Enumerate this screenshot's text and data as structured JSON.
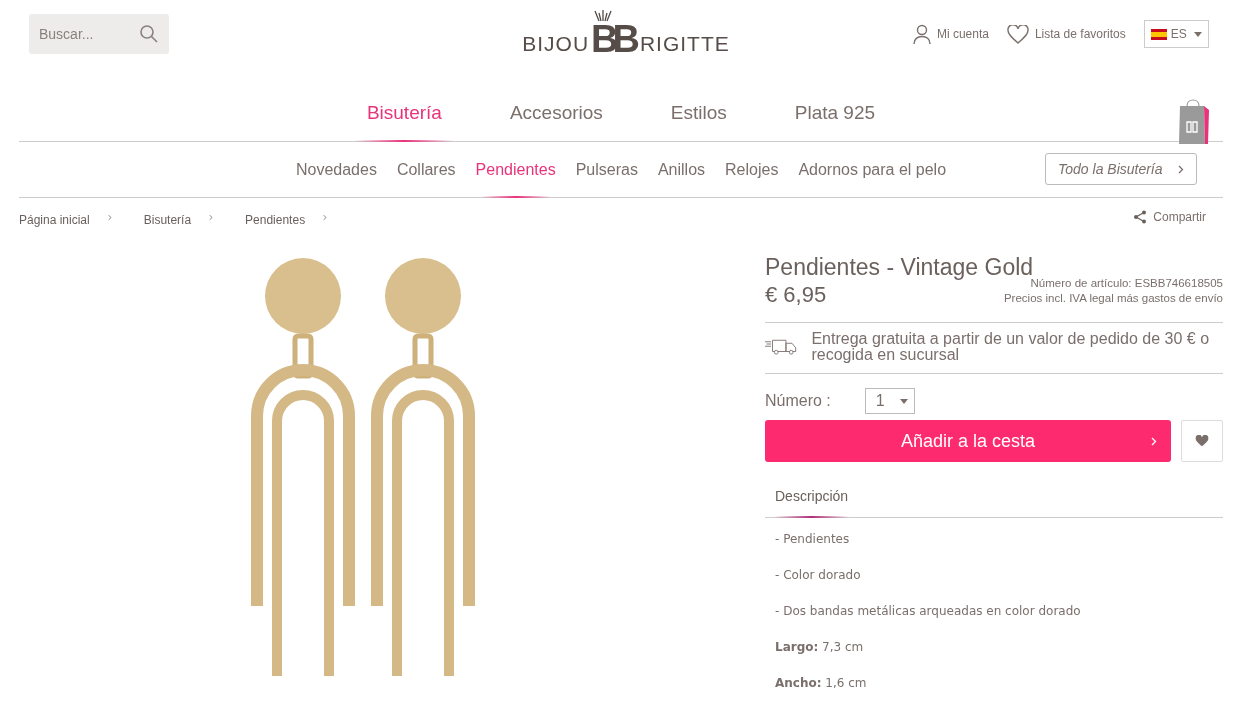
{
  "search": {
    "placeholder": "Buscar..."
  },
  "logo": {
    "left": "BIJOU",
    "mark": "BB",
    "right": "RIGITTE"
  },
  "account": {
    "label": "Mi cuenta"
  },
  "wishlist": {
    "label": "Lista de favoritos"
  },
  "language": {
    "value": "ES"
  },
  "main_nav": [
    {
      "label": "Bisutería",
      "selected": true
    },
    {
      "label": "Accesorios",
      "selected": false
    },
    {
      "label": "Estilos",
      "selected": false
    },
    {
      "label": "Plata 925",
      "selected": false
    }
  ],
  "sub_nav": [
    {
      "label": "Novedades",
      "selected": false
    },
    {
      "label": "Collares",
      "selected": false
    },
    {
      "label": "Pendientes",
      "selected": true
    },
    {
      "label": "Pulseras",
      "selected": false
    },
    {
      "label": "Anillos",
      "selected": false
    },
    {
      "label": "Relojes",
      "selected": false
    },
    {
      "label": "Adornos para el pelo",
      "selected": false
    }
  ],
  "all_button": {
    "label": "Todo la Bisutería"
  },
  "breadcrumb": [
    "Página inicial",
    "Bisutería",
    "Pendientes"
  ],
  "share": {
    "label": "Compartir"
  },
  "product": {
    "title": "Pendientes - Vintage Gold",
    "price": "€ 6,95",
    "article_number": "Número de artículo: ESBB746618505",
    "tax_note": "Precios incl. IVA legal más gastos de envío",
    "delivery_note": "Entrega gratuita a partir de un valor de pedido de 30 € o recogida en sucursal",
    "quantity_label": "Número :",
    "quantity": "1",
    "add_to_cart": "Añadir a la cesta",
    "tabs": [
      {
        "label": "Descripción",
        "selected": true
      }
    ],
    "description": [
      "- Pendientes",
      "- Color dorado",
      "- Dos bandas metálicas arqueadas en color dorado",
      "**Largo:** 7,3 cm",
      "**Ancho:** 1,6 cm"
    ]
  }
}
